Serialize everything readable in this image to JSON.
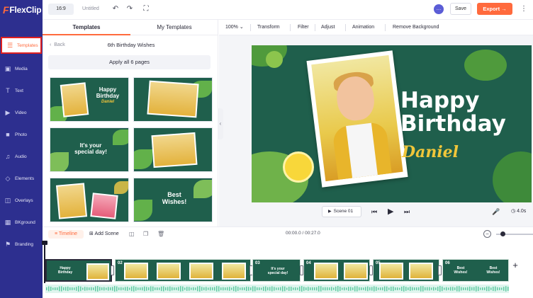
{
  "app": {
    "name": "FlexClip"
  },
  "topbar": {
    "ratio": "16:9",
    "title": "Untitled",
    "save_label": "Save",
    "export_label": "Export →"
  },
  "sidebar": {
    "items": [
      {
        "label": "Templates",
        "icon": "layers-icon"
      },
      {
        "label": "Media",
        "icon": "media-icon"
      },
      {
        "label": "Text",
        "icon": "text-icon"
      },
      {
        "label": "Video",
        "icon": "video-icon"
      },
      {
        "label": "Photo",
        "icon": "photo-icon"
      },
      {
        "label": "Audio",
        "icon": "music-icon"
      },
      {
        "label": "Elements",
        "icon": "elements-icon"
      },
      {
        "label": "Overlays",
        "icon": "overlays-icon"
      },
      {
        "label": "BKground",
        "icon": "background-icon"
      },
      {
        "label": "Branding",
        "icon": "branding-icon"
      }
    ],
    "active_index": 0
  },
  "panel": {
    "tabs": [
      "Templates",
      "My Templates"
    ],
    "active_tab": 0,
    "back_label": "Back",
    "title": "6th Birthday Wishes",
    "apply_label": "Apply all 6 pages",
    "thumbs": [
      {
        "line1": "Happy",
        "line2": "Birthday",
        "line3": "Daniel"
      },
      {
        "line1": "",
        "line2": "",
        "line3": ""
      },
      {
        "line1": "It's your",
        "line2": "special day!",
        "line3": ""
      },
      {
        "line1": "",
        "line2": "",
        "line3": ""
      },
      {
        "line1": "",
        "line2": "",
        "line3": ""
      },
      {
        "line1": "Best",
        "line2": "Wishes!",
        "line3": ""
      }
    ]
  },
  "toolbar": {
    "zoom": "100%",
    "items": [
      "Transform",
      "Filter",
      "Adjust",
      "Animation",
      "Remove Background"
    ]
  },
  "stage": {
    "line1": "Happy",
    "line2": "Birthday",
    "name": "Daniel"
  },
  "playbar": {
    "scene_label": "Scene 01",
    "duration": "4.0s"
  },
  "timeline": {
    "tab_label": "Timeline",
    "add_scene_label": "Add Scene",
    "time_display": "00:00.0 / 00:27.0",
    "clips": [
      {
        "num": "",
        "text1": "Happy",
        "text2": "Birthday"
      },
      {
        "num": "02",
        "text1": "",
        "text2": ""
      },
      {
        "num": "03",
        "text1": "It's your",
        "text2": "special day!"
      },
      {
        "num": "04",
        "text1": "",
        "text2": ""
      },
      {
        "num": "05",
        "text1": "",
        "text2": ""
      },
      {
        "num": "06",
        "text1": "Best",
        "text2": "Wishes!"
      }
    ]
  },
  "colors": {
    "sidebar_bg": "#2d2f8f",
    "accent": "#ff6a3d",
    "stage_bg": "#1f5f4c",
    "name_color": "#f0c63a"
  }
}
